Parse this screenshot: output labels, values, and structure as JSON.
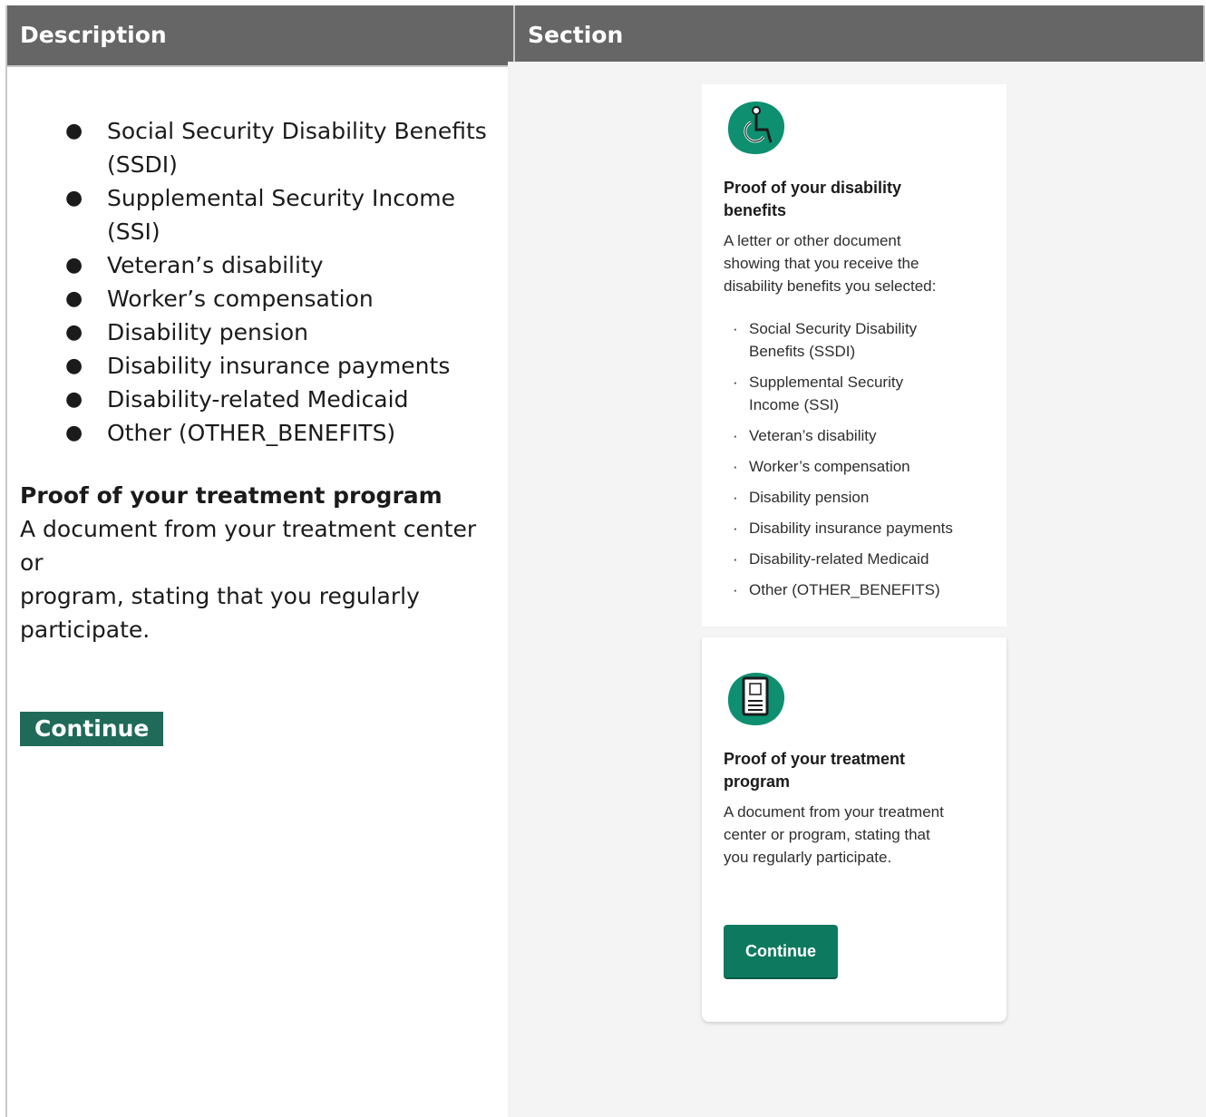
{
  "header": {
    "description_label": "Description",
    "section_label": "Section"
  },
  "left": {
    "items": [
      [
        "Social Security Disability Benefits",
        "(SSDI)"
      ],
      [
        "Supplemental Security Income",
        "(SSI)"
      ],
      [
        "Veteran’s disability"
      ],
      [
        "Worker’s compensation"
      ],
      [
        "Disability pension"
      ],
      [
        "Disability insurance payments"
      ],
      [
        "Disability-related Medicaid"
      ],
      [
        "Other (OTHER_BENEFITS)"
      ]
    ],
    "bullet": "●",
    "treatment_title": "Proof of your treatment program",
    "treatment_body_lines": [
      "A document from your treatment center or",
      "program, stating that you regularly",
      "participate."
    ],
    "continue_label": "Continue"
  },
  "card1": {
    "icon": "wheelchair-icon",
    "title_lines": [
      "Proof of your disability",
      "benefits"
    ],
    "body_lines": [
      "A letter or other document",
      "showing that you receive the",
      "disability benefits you selected:"
    ],
    "bullet": "·",
    "items": [
      [
        "Social Security Disability",
        "Benefits (SSDI)"
      ],
      [
        "Supplemental Security",
        "Income (SSI)"
      ],
      [
        "Veteran’s disability"
      ],
      [
        "Worker’s compensation"
      ],
      [
        "Disability pension"
      ],
      [
        "Disability insurance payments"
      ],
      [
        "Disability-related Medicaid"
      ],
      [
        "Other (OTHER_BENEFITS)"
      ]
    ]
  },
  "card2": {
    "icon": "document-icon",
    "title_lines": [
      "Proof of your treatment",
      "program"
    ],
    "body_lines": [
      "A document from your treatment",
      "center or program, stating that",
      "you regularly participate."
    ],
    "continue_label": "Continue"
  },
  "colors": {
    "header_bg": "#666666",
    "accent_green": "#0d7a5f",
    "left_button_bg": "#1f6a58"
  }
}
